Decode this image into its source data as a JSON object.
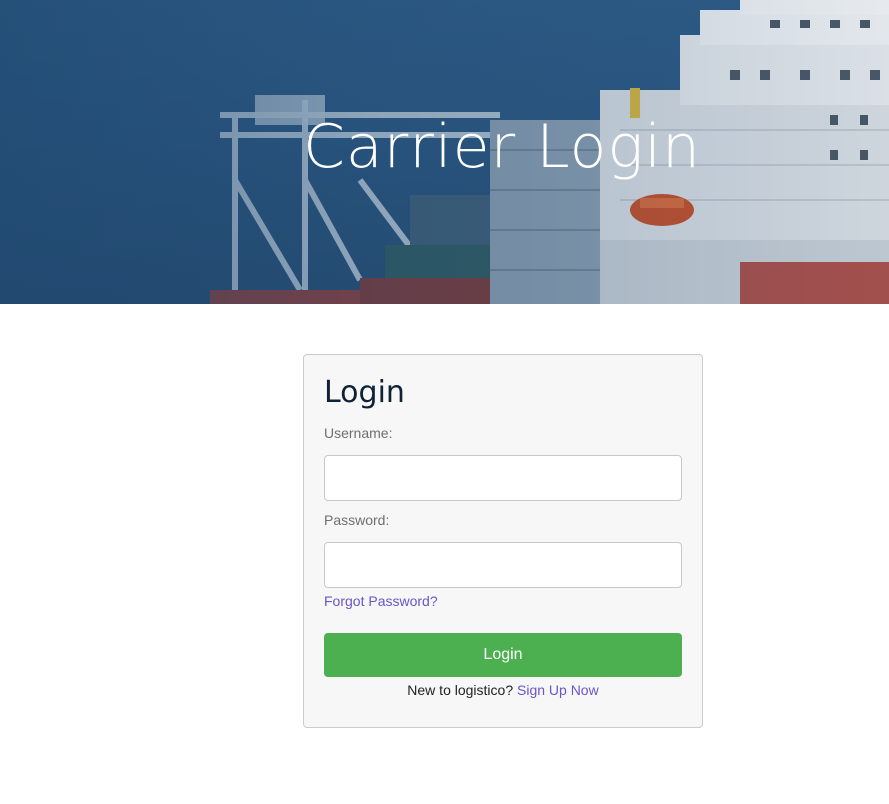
{
  "hero": {
    "title": "Carrier Login"
  },
  "login": {
    "heading": "Login",
    "username_label": "Username:",
    "username_value": "",
    "password_label": "Password:",
    "password_value": "",
    "forgot_label": "Forgot Password?",
    "button_label": "Login",
    "signup_prompt": "New to logistico?",
    "signup_link": "Sign Up Now"
  },
  "colors": {
    "accent_button": "#4caf50",
    "link": "#6a55c9",
    "heading": "#0d2236"
  }
}
